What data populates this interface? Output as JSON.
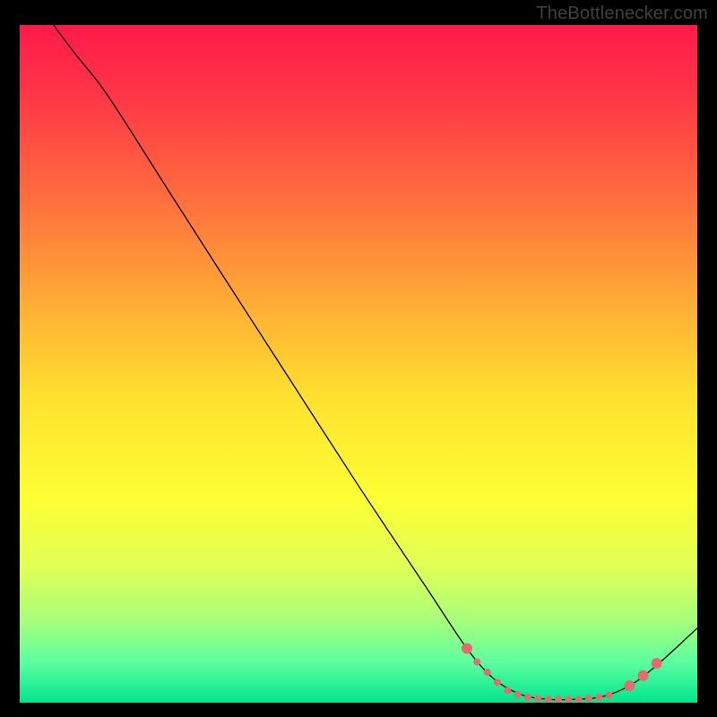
{
  "watermark": "TheBottlenecker.com",
  "chart_data": {
    "type": "line",
    "title": "",
    "xlabel": "",
    "ylabel": "",
    "xlim": [
      0,
      100
    ],
    "ylim": [
      0,
      100
    ],
    "grid": false,
    "legend": false,
    "background": {
      "type": "vertical-gradient",
      "stops": [
        {
          "offset": 0.0,
          "color": "#ff1a4a"
        },
        {
          "offset": 0.1,
          "color": "#ff3547"
        },
        {
          "offset": 0.25,
          "color": "#ff6b3e"
        },
        {
          "offset": 0.4,
          "color": "#ffa836"
        },
        {
          "offset": 0.55,
          "color": "#ffe12f"
        },
        {
          "offset": 0.7,
          "color": "#fdff33"
        },
        {
          "offset": 0.8,
          "color": "#e0ff56"
        },
        {
          "offset": 0.88,
          "color": "#a6ff7c"
        },
        {
          "offset": 0.94,
          "color": "#5cffa0"
        },
        {
          "offset": 1.0,
          "color": "#00e58d"
        }
      ]
    },
    "series": [
      {
        "name": "curve",
        "color": "#000000",
        "stroke_width": 1.3,
        "points": [
          {
            "x": 5.0,
            "y": 100.0
          },
          {
            "x": 8.0,
            "y": 96.0
          },
          {
            "x": 12.0,
            "y": 91.0
          },
          {
            "x": 16.0,
            "y": 85.0
          },
          {
            "x": 22.0,
            "y": 75.5
          },
          {
            "x": 30.0,
            "y": 63.0
          },
          {
            "x": 40.0,
            "y": 47.5
          },
          {
            "x": 50.0,
            "y": 32.0
          },
          {
            "x": 60.0,
            "y": 17.0
          },
          {
            "x": 66.0,
            "y": 8.0
          },
          {
            "x": 70.0,
            "y": 3.5
          },
          {
            "x": 74.0,
            "y": 1.2
          },
          {
            "x": 78.0,
            "y": 0.5
          },
          {
            "x": 82.0,
            "y": 0.5
          },
          {
            "x": 86.0,
            "y": 0.9
          },
          {
            "x": 90.0,
            "y": 2.5
          },
          {
            "x": 94.0,
            "y": 5.5
          },
          {
            "x": 100.0,
            "y": 11.0
          }
        ]
      }
    ],
    "markers": {
      "color": "#e86a6f",
      "radius_small": 4.0,
      "radius_large": 6.0,
      "points": [
        {
          "x": 66.0,
          "y": 8.0,
          "r": "large"
        },
        {
          "x": 67.5,
          "y": 6.0,
          "r": "small"
        },
        {
          "x": 69.0,
          "y": 4.5,
          "r": "small"
        },
        {
          "x": 70.5,
          "y": 3.0,
          "r": "small"
        },
        {
          "x": 72.0,
          "y": 1.8,
          "r": "small"
        },
        {
          "x": 73.5,
          "y": 1.2,
          "r": "small"
        },
        {
          "x": 75.0,
          "y": 0.8,
          "r": "small"
        },
        {
          "x": 76.5,
          "y": 0.6,
          "r": "small"
        },
        {
          "x": 78.0,
          "y": 0.5,
          "r": "small"
        },
        {
          "x": 79.5,
          "y": 0.5,
          "r": "small"
        },
        {
          "x": 81.0,
          "y": 0.5,
          "r": "small"
        },
        {
          "x": 82.5,
          "y": 0.5,
          "r": "small"
        },
        {
          "x": 84.0,
          "y": 0.6,
          "r": "small"
        },
        {
          "x": 85.5,
          "y": 0.8,
          "r": "small"
        },
        {
          "x": 87.0,
          "y": 1.1,
          "r": "small"
        },
        {
          "x": 90.0,
          "y": 2.5,
          "r": "large"
        },
        {
          "x": 92.0,
          "y": 4.0,
          "r": "large"
        },
        {
          "x": 94.0,
          "y": 5.8,
          "r": "large"
        }
      ]
    }
  }
}
